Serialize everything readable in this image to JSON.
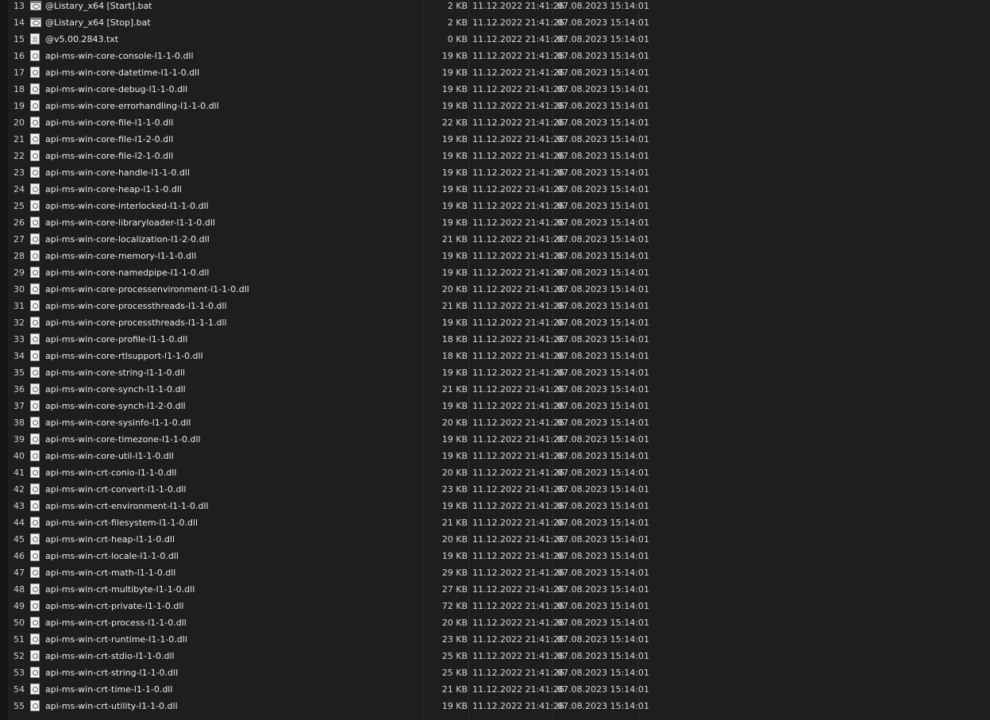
{
  "files": [
    {
      "index": "13",
      "icon": "bat-file-icon",
      "name": "@Listary_x64 [Start].bat",
      "size": "2 KB",
      "created": "11.12.2022 21:41:26",
      "modified": "07.08.2023 15:14:01"
    },
    {
      "index": "14",
      "icon": "bat-file-icon",
      "name": "@Listary_x64 [Stop].bat",
      "size": "2 KB",
      "created": "11.12.2022 21:41:26",
      "modified": "07.08.2023 15:14:01"
    },
    {
      "index": "15",
      "icon": "text-file-icon",
      "name": "@v5.00.2843.txt",
      "size": "0 KB",
      "created": "11.12.2022 21:41:26",
      "modified": "07.08.2023 15:14:01"
    },
    {
      "index": "16",
      "icon": "dll-file-icon",
      "name": "api-ms-win-core-console-l1-1-0.dll",
      "size": "19 KB",
      "created": "11.12.2022 21:41:26",
      "modified": "07.08.2023 15:14:01"
    },
    {
      "index": "17",
      "icon": "dll-file-icon",
      "name": "api-ms-win-core-datetime-l1-1-0.dll",
      "size": "19 KB",
      "created": "11.12.2022 21:41:26",
      "modified": "07.08.2023 15:14:01"
    },
    {
      "index": "18",
      "icon": "dll-file-icon",
      "name": "api-ms-win-core-debug-l1-1-0.dll",
      "size": "19 KB",
      "created": "11.12.2022 21:41:26",
      "modified": "07.08.2023 15:14:01"
    },
    {
      "index": "19",
      "icon": "dll-file-icon",
      "name": "api-ms-win-core-errorhandling-l1-1-0.dll",
      "size": "19 KB",
      "created": "11.12.2022 21:41:26",
      "modified": "07.08.2023 15:14:01"
    },
    {
      "index": "20",
      "icon": "dll-file-icon",
      "name": "api-ms-win-core-file-l1-1-0.dll",
      "size": "22 KB",
      "created": "11.12.2022 21:41:26",
      "modified": "07.08.2023 15:14:01"
    },
    {
      "index": "21",
      "icon": "dll-file-icon",
      "name": "api-ms-win-core-file-l1-2-0.dll",
      "size": "19 KB",
      "created": "11.12.2022 21:41:26",
      "modified": "07.08.2023 15:14:01"
    },
    {
      "index": "22",
      "icon": "dll-file-icon",
      "name": "api-ms-win-core-file-l2-1-0.dll",
      "size": "19 KB",
      "created": "11.12.2022 21:41:26",
      "modified": "07.08.2023 15:14:01"
    },
    {
      "index": "23",
      "icon": "dll-file-icon",
      "name": "api-ms-win-core-handle-l1-1-0.dll",
      "size": "19 KB",
      "created": "11.12.2022 21:41:26",
      "modified": "07.08.2023 15:14:01"
    },
    {
      "index": "24",
      "icon": "dll-file-icon",
      "name": "api-ms-win-core-heap-l1-1-0.dll",
      "size": "19 KB",
      "created": "11.12.2022 21:41:26",
      "modified": "07.08.2023 15:14:01"
    },
    {
      "index": "25",
      "icon": "dll-file-icon",
      "name": "api-ms-win-core-interlocked-l1-1-0.dll",
      "size": "19 KB",
      "created": "11.12.2022 21:41:26",
      "modified": "07.08.2023 15:14:01"
    },
    {
      "index": "26",
      "icon": "dll-file-icon",
      "name": "api-ms-win-core-libraryloader-l1-1-0.dll",
      "size": "19 KB",
      "created": "11.12.2022 21:41:26",
      "modified": "07.08.2023 15:14:01"
    },
    {
      "index": "27",
      "icon": "dll-file-icon",
      "name": "api-ms-win-core-localization-l1-2-0.dll",
      "size": "21 KB",
      "created": "11.12.2022 21:41:26",
      "modified": "07.08.2023 15:14:01"
    },
    {
      "index": "28",
      "icon": "dll-file-icon",
      "name": "api-ms-win-core-memory-l1-1-0.dll",
      "size": "19 KB",
      "created": "11.12.2022 21:41:26",
      "modified": "07.08.2023 15:14:01"
    },
    {
      "index": "29",
      "icon": "dll-file-icon",
      "name": "api-ms-win-core-namedpipe-l1-1-0.dll",
      "size": "19 KB",
      "created": "11.12.2022 21:41:26",
      "modified": "07.08.2023 15:14:01"
    },
    {
      "index": "30",
      "icon": "dll-file-icon",
      "name": "api-ms-win-core-processenvironment-l1-1-0.dll",
      "size": "20 KB",
      "created": "11.12.2022 21:41:26",
      "modified": "07.08.2023 15:14:01"
    },
    {
      "index": "31",
      "icon": "dll-file-icon",
      "name": "api-ms-win-core-processthreads-l1-1-0.dll",
      "size": "21 KB",
      "created": "11.12.2022 21:41:26",
      "modified": "07.08.2023 15:14:01"
    },
    {
      "index": "32",
      "icon": "dll-file-icon",
      "name": "api-ms-win-core-processthreads-l1-1-1.dll",
      "size": "19 KB",
      "created": "11.12.2022 21:41:26",
      "modified": "07.08.2023 15:14:01"
    },
    {
      "index": "33",
      "icon": "dll-file-icon",
      "name": "api-ms-win-core-profile-l1-1-0.dll",
      "size": "18 KB",
      "created": "11.12.2022 21:41:26",
      "modified": "07.08.2023 15:14:01"
    },
    {
      "index": "34",
      "icon": "dll-file-icon",
      "name": "api-ms-win-core-rtlsupport-l1-1-0.dll",
      "size": "18 KB",
      "created": "11.12.2022 21:41:26",
      "modified": "07.08.2023 15:14:01"
    },
    {
      "index": "35",
      "icon": "dll-file-icon",
      "name": "api-ms-win-core-string-l1-1-0.dll",
      "size": "19 KB",
      "created": "11.12.2022 21:41:26",
      "modified": "07.08.2023 15:14:01"
    },
    {
      "index": "36",
      "icon": "dll-file-icon",
      "name": "api-ms-win-core-synch-l1-1-0.dll",
      "size": "21 KB",
      "created": "11.12.2022 21:41:26",
      "modified": "07.08.2023 15:14:01"
    },
    {
      "index": "37",
      "icon": "dll-file-icon",
      "name": "api-ms-win-core-synch-l1-2-0.dll",
      "size": "19 KB",
      "created": "11.12.2022 21:41:26",
      "modified": "07.08.2023 15:14:01"
    },
    {
      "index": "38",
      "icon": "dll-file-icon",
      "name": "api-ms-win-core-sysinfo-l1-1-0.dll",
      "size": "20 KB",
      "created": "11.12.2022 21:41:26",
      "modified": "07.08.2023 15:14:01"
    },
    {
      "index": "39",
      "icon": "dll-file-icon",
      "name": "api-ms-win-core-timezone-l1-1-0.dll",
      "size": "19 KB",
      "created": "11.12.2022 21:41:26",
      "modified": "07.08.2023 15:14:01"
    },
    {
      "index": "40",
      "icon": "dll-file-icon",
      "name": "api-ms-win-core-util-l1-1-0.dll",
      "size": "19 KB",
      "created": "11.12.2022 21:41:26",
      "modified": "07.08.2023 15:14:01"
    },
    {
      "index": "41",
      "icon": "dll-file-icon",
      "name": "api-ms-win-crt-conio-l1-1-0.dll",
      "size": "20 KB",
      "created": "11.12.2022 21:41:26",
      "modified": "07.08.2023 15:14:01"
    },
    {
      "index": "42",
      "icon": "dll-file-icon",
      "name": "api-ms-win-crt-convert-l1-1-0.dll",
      "size": "23 KB",
      "created": "11.12.2022 21:41:26",
      "modified": "07.08.2023 15:14:01"
    },
    {
      "index": "43",
      "icon": "dll-file-icon",
      "name": "api-ms-win-crt-environment-l1-1-0.dll",
      "size": "19 KB",
      "created": "11.12.2022 21:41:26",
      "modified": "07.08.2023 15:14:01"
    },
    {
      "index": "44",
      "icon": "dll-file-icon",
      "name": "api-ms-win-crt-filesystem-l1-1-0.dll",
      "size": "21 KB",
      "created": "11.12.2022 21:41:26",
      "modified": "07.08.2023 15:14:01"
    },
    {
      "index": "45",
      "icon": "dll-file-icon",
      "name": "api-ms-win-crt-heap-l1-1-0.dll",
      "size": "20 KB",
      "created": "11.12.2022 21:41:26",
      "modified": "07.08.2023 15:14:01"
    },
    {
      "index": "46",
      "icon": "dll-file-icon",
      "name": "api-ms-win-crt-locale-l1-1-0.dll",
      "size": "19 KB",
      "created": "11.12.2022 21:41:26",
      "modified": "07.08.2023 15:14:01"
    },
    {
      "index": "47",
      "icon": "dll-file-icon",
      "name": "api-ms-win-crt-math-l1-1-0.dll",
      "size": "29 KB",
      "created": "11.12.2022 21:41:26",
      "modified": "07.08.2023 15:14:01"
    },
    {
      "index": "48",
      "icon": "dll-file-icon",
      "name": "api-ms-win-crt-multibyte-l1-1-0.dll",
      "size": "27 KB",
      "created": "11.12.2022 21:41:26",
      "modified": "07.08.2023 15:14:01"
    },
    {
      "index": "49",
      "icon": "dll-file-icon",
      "name": "api-ms-win-crt-private-l1-1-0.dll",
      "size": "72 KB",
      "created": "11.12.2022 21:41:26",
      "modified": "07.08.2023 15:14:01"
    },
    {
      "index": "50",
      "icon": "dll-file-icon",
      "name": "api-ms-win-crt-process-l1-1-0.dll",
      "size": "20 KB",
      "created": "11.12.2022 21:41:26",
      "modified": "07.08.2023 15:14:01"
    },
    {
      "index": "51",
      "icon": "dll-file-icon",
      "name": "api-ms-win-crt-runtime-l1-1-0.dll",
      "size": "23 KB",
      "created": "11.12.2022 21:41:26",
      "modified": "07.08.2023 15:14:01"
    },
    {
      "index": "52",
      "icon": "dll-file-icon",
      "name": "api-ms-win-crt-stdio-l1-1-0.dll",
      "size": "25 KB",
      "created": "11.12.2022 21:41:26",
      "modified": "07.08.2023 15:14:01"
    },
    {
      "index": "53",
      "icon": "dll-file-icon",
      "name": "api-ms-win-crt-string-l1-1-0.dll",
      "size": "25 KB",
      "created": "11.12.2022 21:41:26",
      "modified": "07.08.2023 15:14:01"
    },
    {
      "index": "54",
      "icon": "dll-file-icon",
      "name": "api-ms-win-crt-time-l1-1-0.dll",
      "size": "21 KB",
      "created": "11.12.2022 21:41:26",
      "modified": "07.08.2023 15:14:01"
    },
    {
      "index": "55",
      "icon": "dll-file-icon",
      "name": "api-ms-win-crt-utility-l1-1-0.dll",
      "size": "19 KB",
      "created": "11.12.2022 21:41:26",
      "modified": "07.08.2023 15:14:01"
    }
  ],
  "colors": {
    "background": "#1e1e1e",
    "text": "#e6e6e6",
    "column_divider": "#2e2e2e"
  }
}
